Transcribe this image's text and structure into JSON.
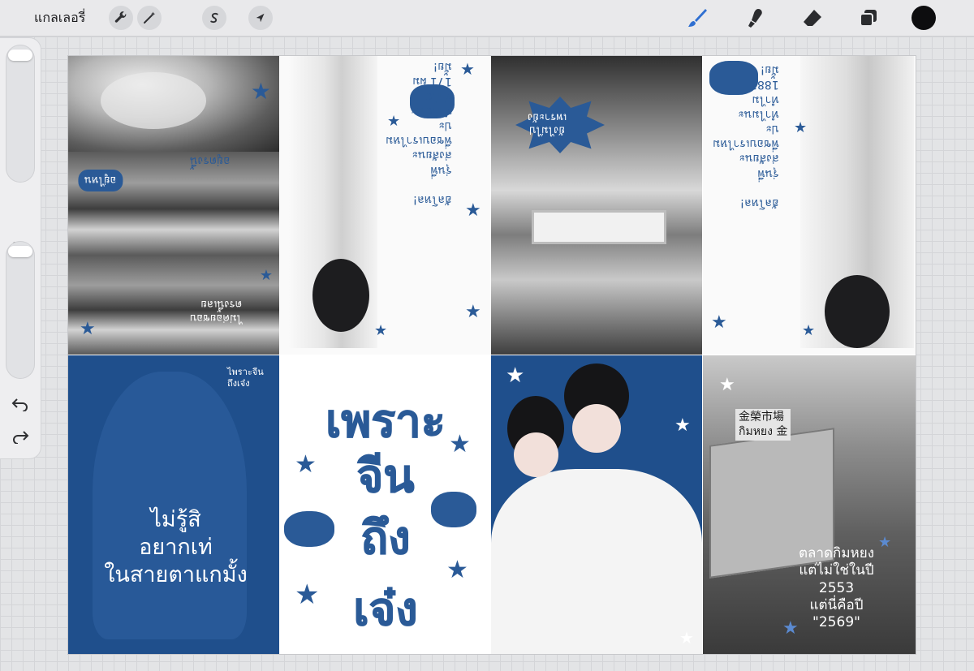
{
  "toolbar": {
    "gallery_label": "แกลเลอรี่",
    "left_tools": [
      "wrench-icon",
      "magic-wand-icon",
      "selection-s-icon",
      "arrow-cursor-icon"
    ],
    "right_tools": [
      "brush-icon",
      "smudge-icon",
      "eraser-icon",
      "layers-icon"
    ],
    "accent_color": "#2f6fd1",
    "current_color": "#0d0d0f"
  },
  "canvas": {
    "panels": {
      "bottom_left_text": "ไม่รู้สิ\nอยากเท่\nในสายตาแกมั้ง",
      "bottom_left_signature": "ไพราะจีน\nถึงเจ๋ง",
      "title_lines": [
        "เพราะ",
        "จีน",
        "ถึง",
        "เจ๋ง"
      ],
      "bottom_right_text": "ตลาดกิมหยง\nแต่ไม่ใช่ในปี\n2553\nแต่นี่คือปี\n\"2569\"",
      "billboard_sign": "金榮市場\nกิมหยง 金",
      "top_left_caption_1": "อยู่ไหน",
      "top_left_caption_2": "อยู่ตรงนี้",
      "top_left_caption_3": "ไม่ค่อยชอบ\nตรงนี้เลย",
      "sketch_text_1": "ฮัลโหล!\n\nรุ่นพี่\nส่งสัยนะ\nพี่ชอบเราไหม\nปะ\nทำไมนะ\nทำไม\n171 ผม\nมั้ย!",
      "temple_caption": "ยังไม่ไป\nเพราะยัง",
      "sketch_text_2": "ฮัลโหล!\n\nรุ่นพี่\nส่งสัยนะ\nพี่ชอบเราไหม\nปะ\nทำไมนะ\nทำไม\n1881\nมั้ย!"
    },
    "brand_blue": "#1f4f8c"
  }
}
